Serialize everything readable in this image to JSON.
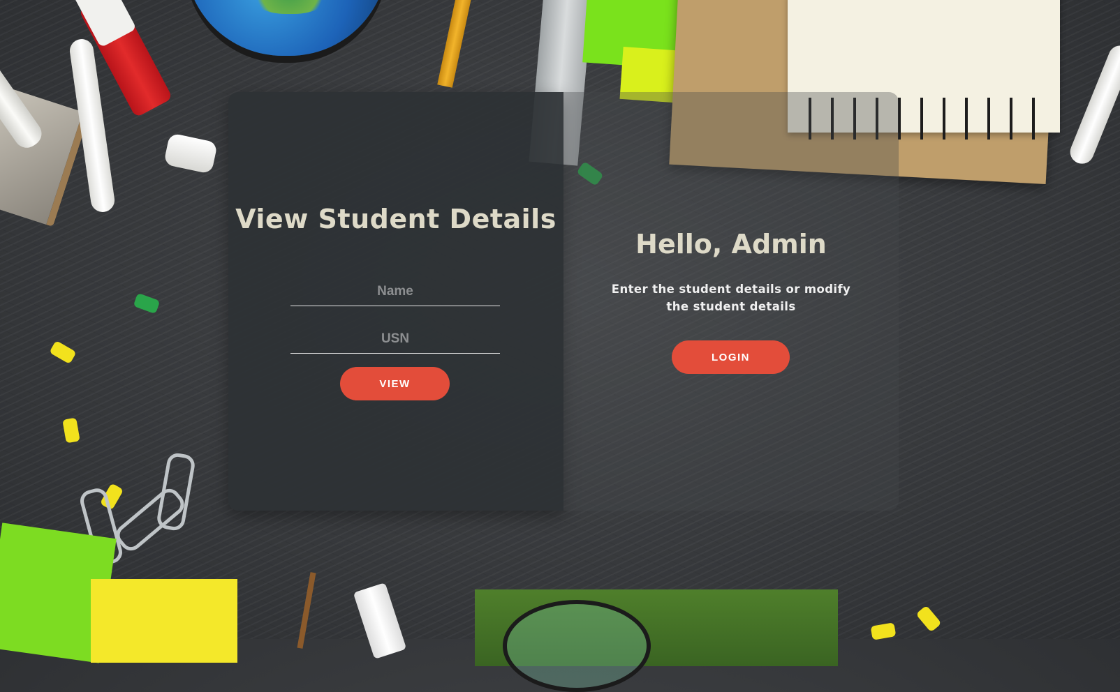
{
  "view_panel": {
    "title": "View Student Details",
    "name_placeholder": "Name",
    "name_value": "",
    "usn_placeholder": "USN",
    "usn_value": "",
    "view_button_label": "VIEW"
  },
  "admin_panel": {
    "greeting": "Hello, Admin",
    "message": "Enter the student details or modify the student details",
    "login_button_label": "LOGIN"
  },
  "colors": {
    "accent": "#e34d3a",
    "title_text": "#dedac8",
    "panel_background": "#2d3135"
  },
  "icons": {
    "background": "chalkboard-desk-background"
  }
}
